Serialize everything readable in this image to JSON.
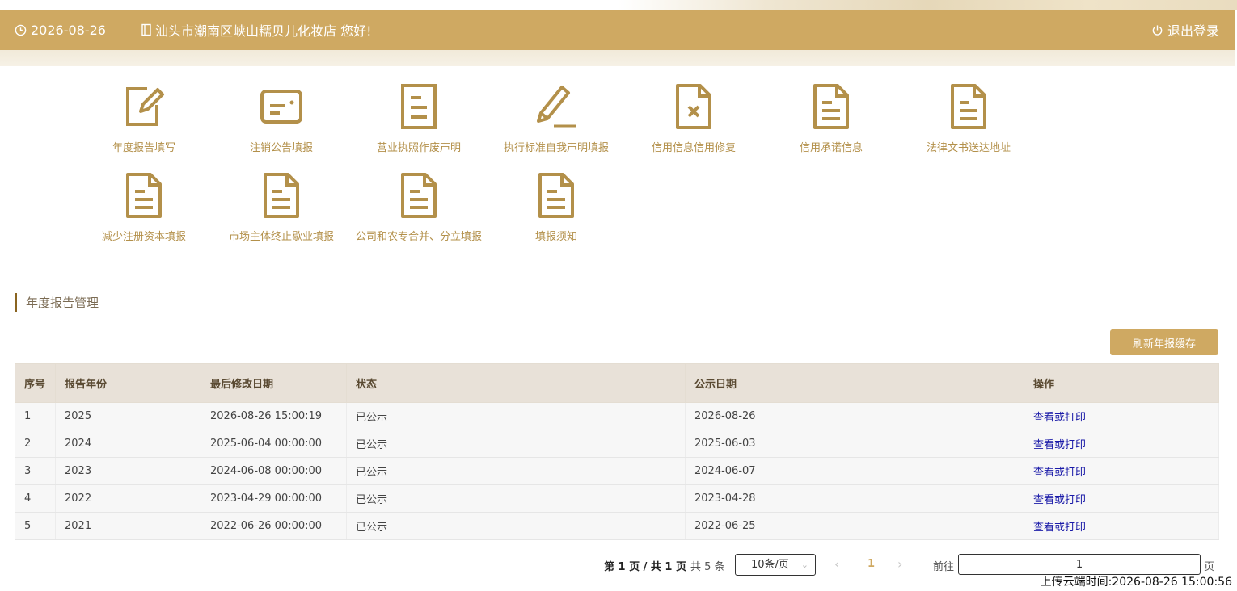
{
  "header": {
    "date": "2026-08-26",
    "greeting": "汕头市潮南区峡山糯贝儿化妆店 您好!",
    "logout_label": "退出登录"
  },
  "colors": {
    "accent": "#cfa962",
    "icon": "#b3904a",
    "link": "#1a1aa8",
    "table_header_bg": "#e8e1d8"
  },
  "menu": [
    {
      "label": "年度报告填写",
      "icon": "edit-icon"
    },
    {
      "label": "注销公告填报",
      "icon": "card-icon"
    },
    {
      "label": "营业执照作废声明",
      "icon": "document-icon"
    },
    {
      "label": "执行标准自我声明填报",
      "icon": "pencil-icon"
    },
    {
      "label": "信用信息信用修复",
      "icon": "document-x-icon"
    },
    {
      "label": "信用承诺信息",
      "icon": "document-icon"
    },
    {
      "label": "法律文书送达地址",
      "icon": "document-icon"
    },
    {
      "label": "减少注册资本填报",
      "icon": "document-icon"
    },
    {
      "label": "市场主体终止歇业填报",
      "icon": "document-icon"
    },
    {
      "label": "公司和农专合并、分立填报",
      "icon": "document-icon"
    },
    {
      "label": "填报须知",
      "icon": "document-icon"
    }
  ],
  "section": {
    "title": "年度报告管理",
    "refresh_label": "刷新年报缓存"
  },
  "table": {
    "headers": [
      "序号",
      "报告年份",
      "最后修改日期",
      "状态",
      "公示日期",
      "操作"
    ],
    "rows": [
      {
        "no": "1",
        "year": "2025",
        "modified": "2026-08-26 15:00:19",
        "status": "已公示",
        "publish": "2026-08-26",
        "action": "查看或打印"
      },
      {
        "no": "2",
        "year": "2024",
        "modified": "2025-06-04 00:00:00",
        "status": "已公示",
        "publish": "2025-06-03",
        "action": "查看或打印"
      },
      {
        "no": "3",
        "year": "2023",
        "modified": "2024-06-08 00:00:00",
        "status": "已公示",
        "publish": "2024-06-07",
        "action": "查看或打印"
      },
      {
        "no": "4",
        "year": "2022",
        "modified": "2023-04-29 00:00:00",
        "status": "已公示",
        "publish": "2023-04-28",
        "action": "查看或打印"
      },
      {
        "no": "5",
        "year": "2021",
        "modified": "2022-06-26 00:00:00",
        "status": "已公示",
        "publish": "2022-06-25",
        "action": "查看或打印"
      }
    ]
  },
  "pagination": {
    "page_info": "第 1 页 / 共 1 页",
    "total": "共 5 条",
    "page_size": "10条/页",
    "current_page": "1",
    "goto_label": "前往",
    "goto_value": "1",
    "page_suffix": "页"
  },
  "upload_time": "上传云端时间:2026-08-26 15:00:56"
}
